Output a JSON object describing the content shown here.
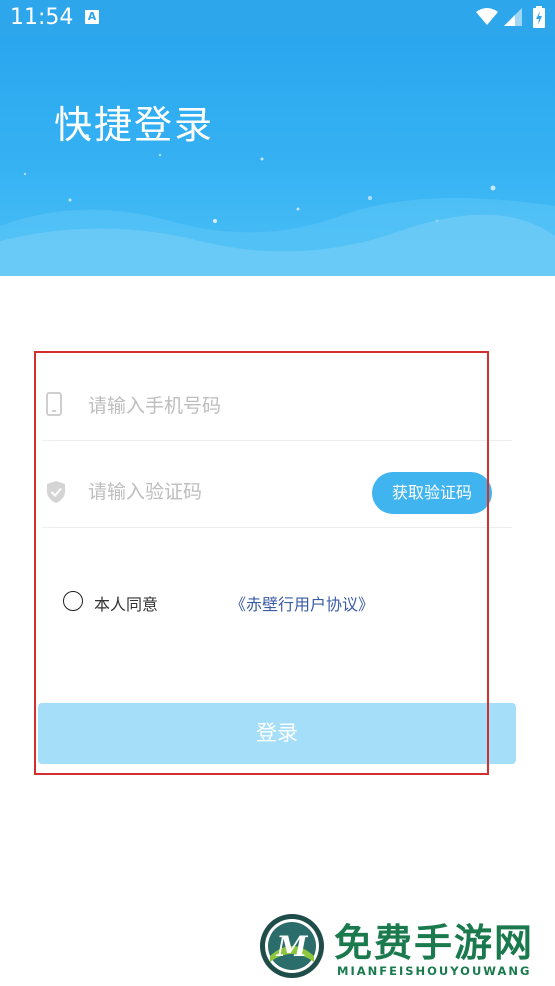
{
  "status_bar": {
    "time": "11:54",
    "notification_icon_letter": "A",
    "icons": [
      "wifi-icon",
      "signal-icon",
      "battery-icon"
    ]
  },
  "header": {
    "title": "快捷登录"
  },
  "form": {
    "phone_placeholder": "请输入手机号码",
    "code_placeholder": "请输入验证码",
    "get_code_button": "获取验证码",
    "agree_text": "本人同意",
    "agreement_link": "《赤壁行用户协议》",
    "login_button": "登录"
  },
  "watermark": {
    "logo_letter": "M",
    "title": "免费手游网",
    "subtitle": "MIANFEISHOUYOUWANG"
  },
  "colors": {
    "brand_blue": "#2ea6ec",
    "button_blue": "#40b4ef",
    "login_disabled": "#a4def9",
    "link_blue": "#3a5ca6",
    "highlight_red": "#d32f2f",
    "watermark_green": "#1a7a4e"
  }
}
